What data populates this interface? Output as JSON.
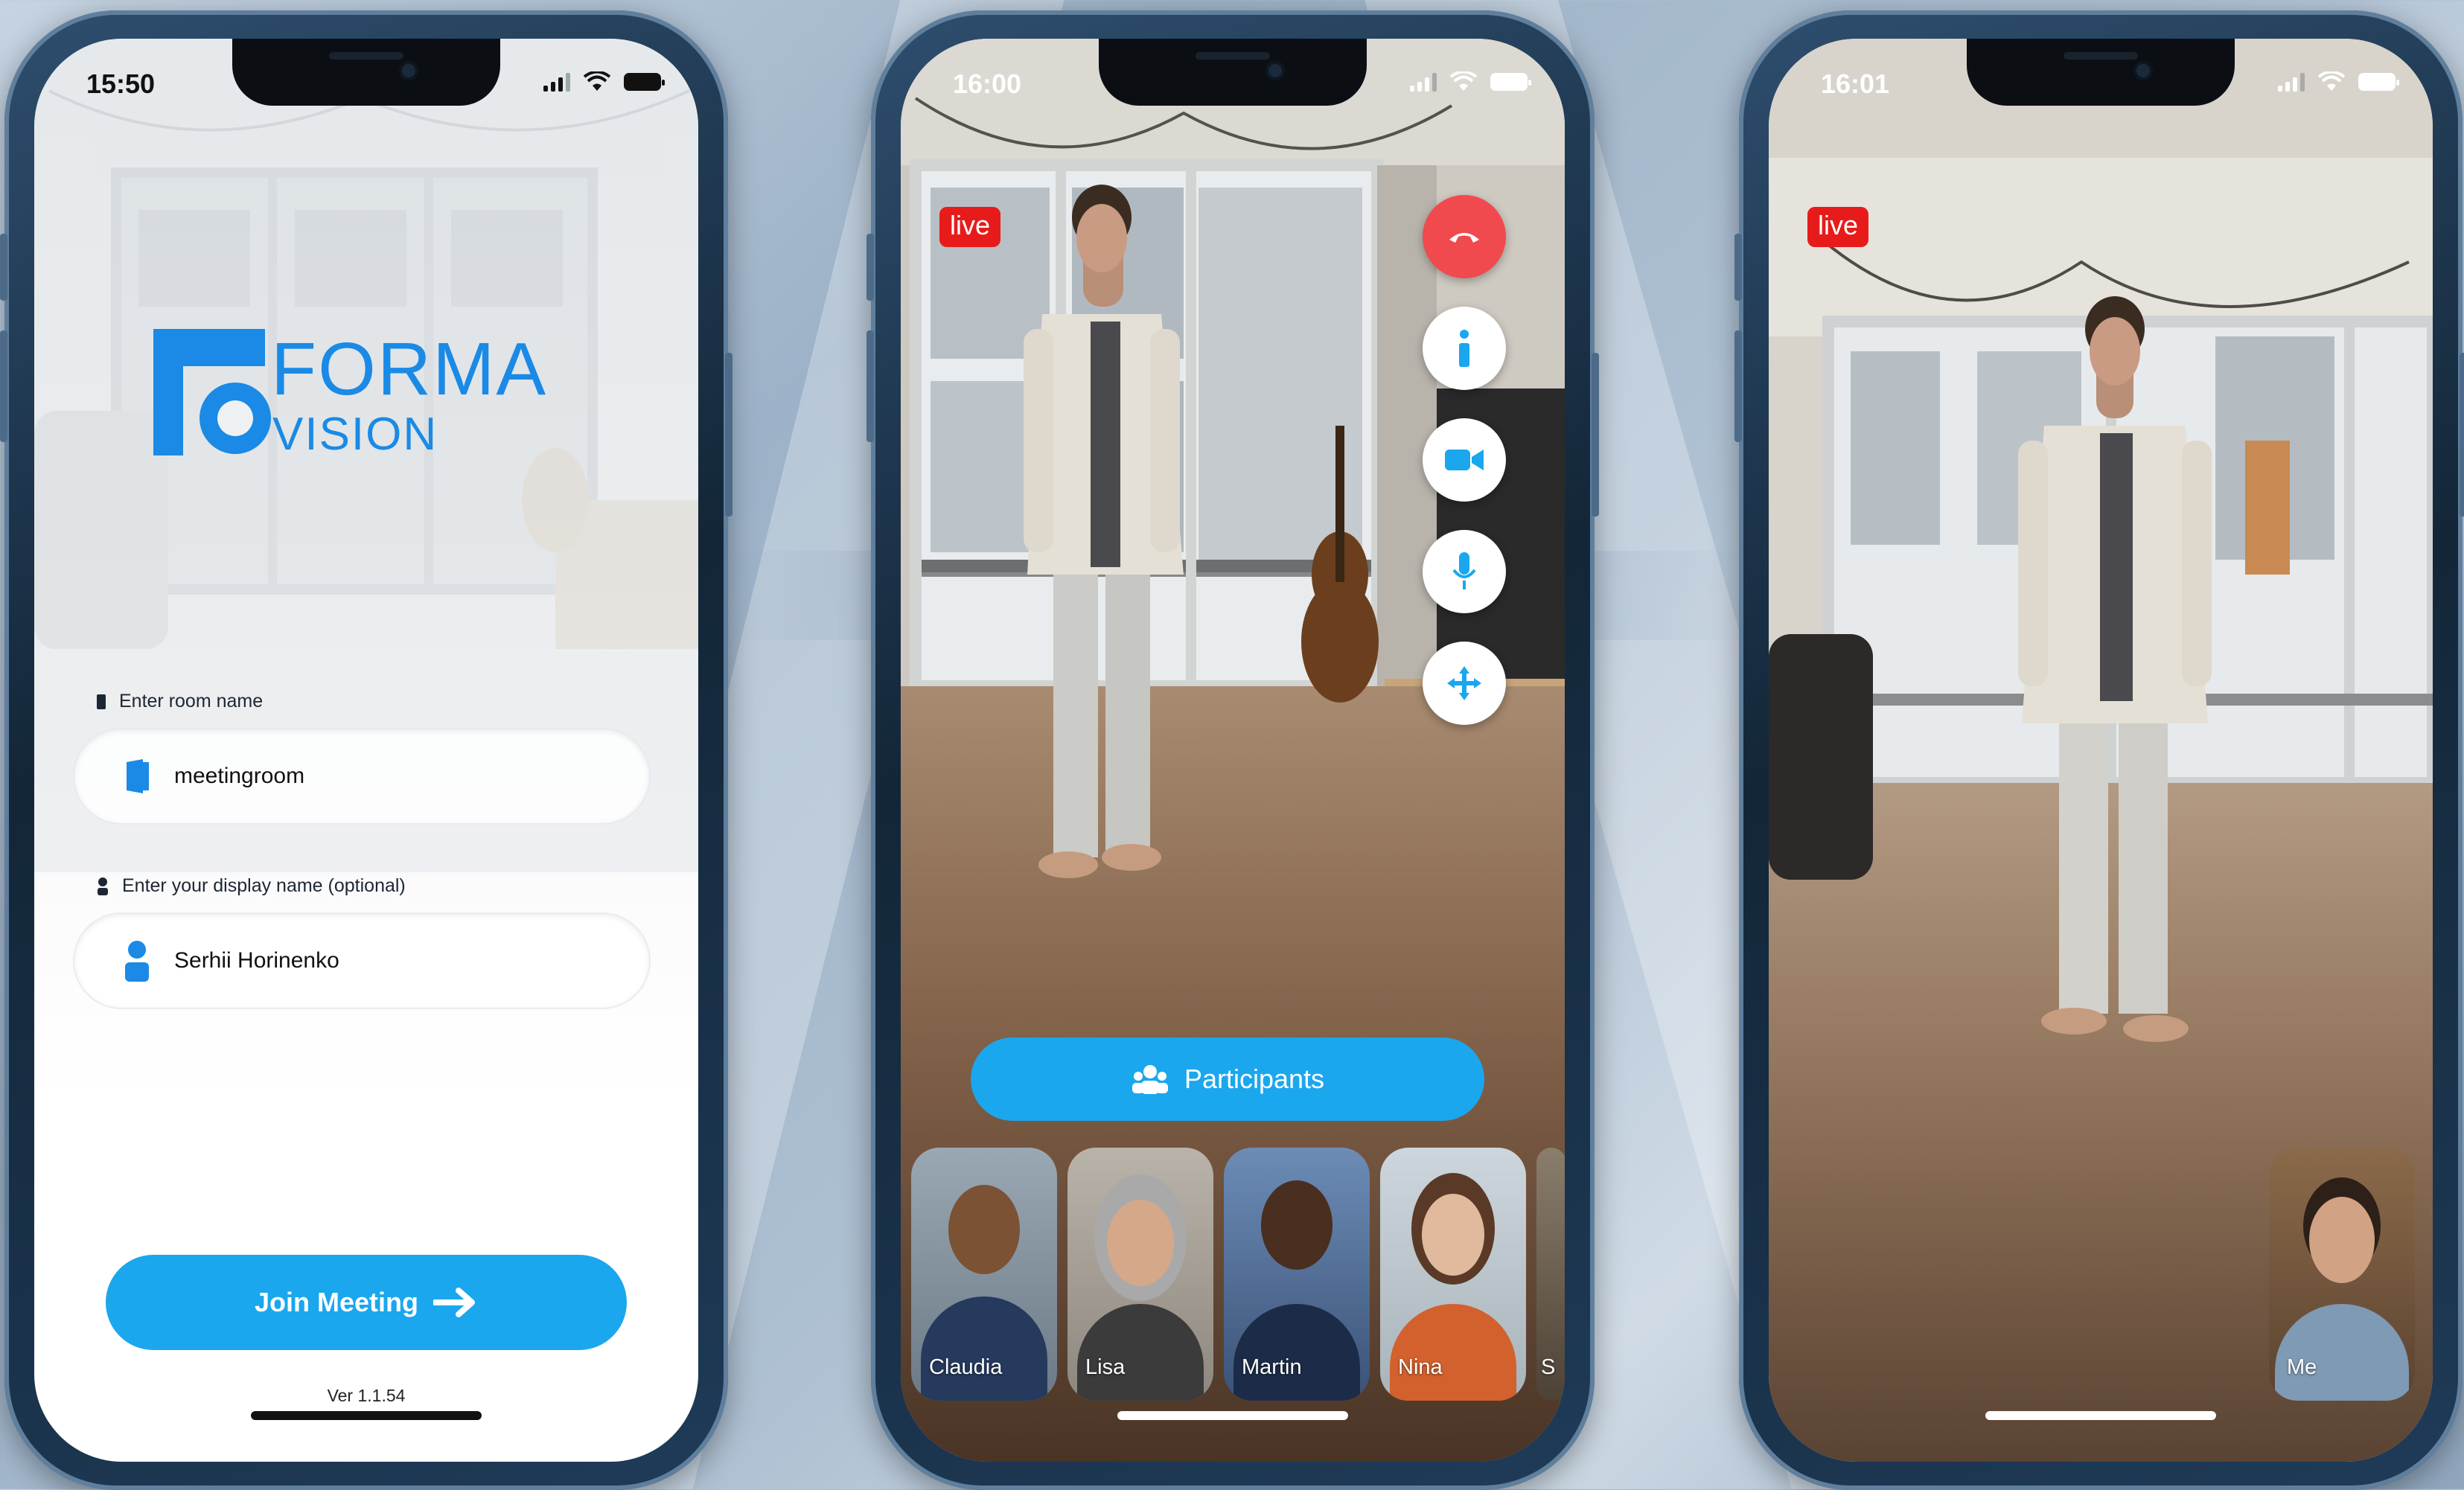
{
  "phone1": {
    "time": "15:50",
    "logo": {
      "line1": "FORMA",
      "line2": "VISION"
    },
    "room_label": "Enter room name",
    "room_value": "meetingroom",
    "display_label": "Enter your display name (optional)",
    "display_value": "Serhii Horinenko",
    "join_label": "Join Meeting",
    "version": "Ver 1.1.54"
  },
  "phone2": {
    "time": "16:00",
    "live_badge": "live",
    "participants_label": "Participants",
    "tiles": [
      {
        "name": "Claudia"
      },
      {
        "name": "Lisa"
      },
      {
        "name": "Martin"
      },
      {
        "name": "Nina"
      },
      {
        "name": "S"
      }
    ]
  },
  "phone3": {
    "time": "16:01",
    "live_badge": "live",
    "self_tile": {
      "name": "Me"
    }
  },
  "colors": {
    "accent": "#1aa7ee",
    "live": "#e81b1b",
    "end_call": "#f04a4f",
    "brand": "#1a8ae6"
  }
}
